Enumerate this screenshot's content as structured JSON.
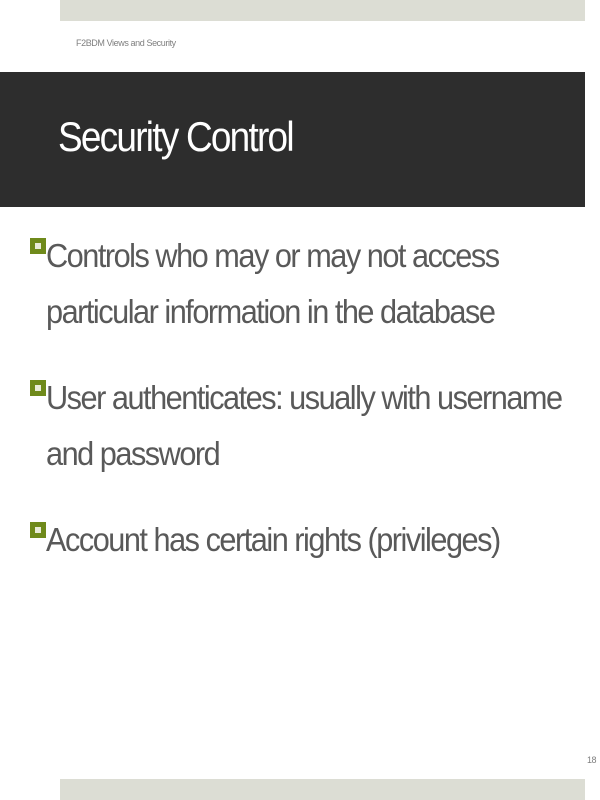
{
  "slide": {
    "header_label": "F2BDM Views and Security",
    "title": "Security Control",
    "bullets": [
      {
        "text": "Controls who may or may not access particular information in the database"
      },
      {
        "text": "User authenticates: usually with username and password"
      },
      {
        "text": "Account has certain rights (privileges)"
      }
    ],
    "page_number": "18"
  },
  "colors": {
    "title_bar": "#2d2d2d",
    "bullet_accent": "#6f8a1b",
    "band": "#dcddd4",
    "body_text": "#595959"
  },
  "icons": {
    "bullet": "square-bullet-icon"
  }
}
